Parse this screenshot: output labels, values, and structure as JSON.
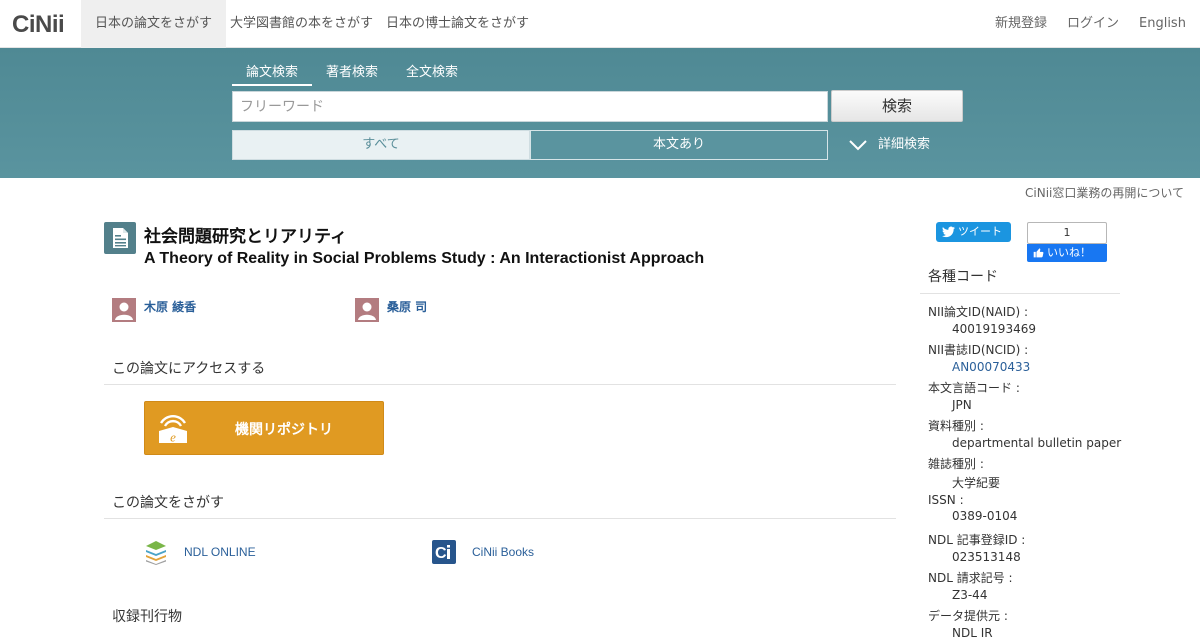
{
  "nav": {
    "logo": "CiNii",
    "tabs": [
      "日本の論文をさがす",
      "大学図書館の本をさがす",
      "日本の博士論文をさがす"
    ],
    "register": "新規登録",
    "login": "ログイン",
    "language": "English"
  },
  "search": {
    "tabs": [
      "論文検索",
      "著者検索",
      "全文検索"
    ],
    "placeholder": "フリーワード",
    "button": "検索",
    "filter_all": "すべて",
    "filter_fulltext": "本文あり",
    "advanced": "詳細検索"
  },
  "notice": "CiNii窓口業務の再開について",
  "article": {
    "title_ja": "社会問題研究とリアリティ",
    "title_en": "A Theory of Reality in Social Problems Study : An Interactionist Approach",
    "authors": [
      "木原 綾香",
      "桑原 司"
    ]
  },
  "access": {
    "heading": "この論文にアクセスする",
    "repository_button": "機関リポジトリ"
  },
  "find": {
    "heading": "この論文をさがす",
    "links": [
      "NDL ONLINE",
      "CiNii Books"
    ]
  },
  "journal_heading": "収録刊行物",
  "sidebar": {
    "tweet": "ツイート",
    "fb_count": "1",
    "fb_like": "いいね！",
    "codes_heading": "各種コード",
    "codes": [
      {
        "label": "NII論文ID(NAID) :",
        "value": "40019193469"
      },
      {
        "label": "NII書誌ID(NCID) :",
        "value": "AN00070433"
      },
      {
        "label": "本文言語コード :",
        "value": "JPN"
      },
      {
        "label": "資料種別 :",
        "value": "departmental bulletin paper"
      },
      {
        "label": "雑誌種別 :",
        "value": "大学紀要"
      },
      {
        "label": "ISSN :",
        "value": "0389-0104"
      },
      {
        "label": "NDL 記事登録ID :",
        "value": "023513148"
      },
      {
        "label": "NDL 請求記号 :",
        "value": "Z3-44"
      },
      {
        "label": "データ提供元 :",
        "value": "NDL  IR"
      }
    ]
  }
}
